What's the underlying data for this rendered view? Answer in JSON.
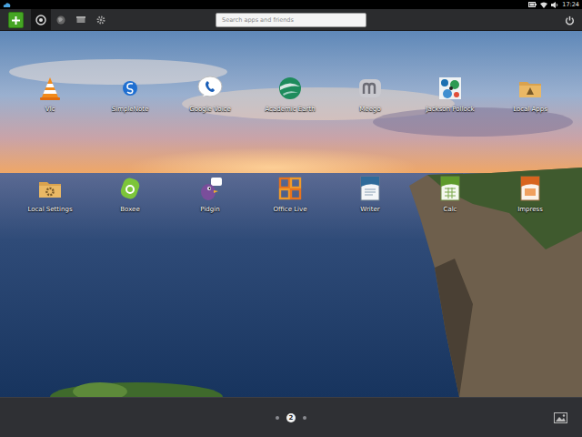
{
  "status_bar": {
    "time": "17:24"
  },
  "toolbar": {
    "tabs": [
      {
        "selected": true
      },
      {
        "selected": false
      },
      {
        "selected": false
      },
      {
        "selected": false
      }
    ]
  },
  "search": {
    "placeholder": "Search apps and friends"
  },
  "apps": [
    {
      "label": "Vlc"
    },
    {
      "label": "SimpleNote"
    },
    {
      "label": "Google Voice"
    },
    {
      "label": "Academic Earth"
    },
    {
      "label": "Meego"
    },
    {
      "label": "Jackson Pollock"
    },
    {
      "label": "Local Apps"
    },
    {
      "label": "Local Settings"
    },
    {
      "label": "Boxee"
    },
    {
      "label": "Pidgin"
    },
    {
      "label": "Office Live"
    },
    {
      "label": "Writer"
    },
    {
      "label": "Calc"
    },
    {
      "label": "Impress"
    }
  ],
  "pager": {
    "pages": [
      {
        "selected": false
      },
      {
        "label": "2",
        "selected": true
      },
      {
        "selected": false
      }
    ]
  }
}
